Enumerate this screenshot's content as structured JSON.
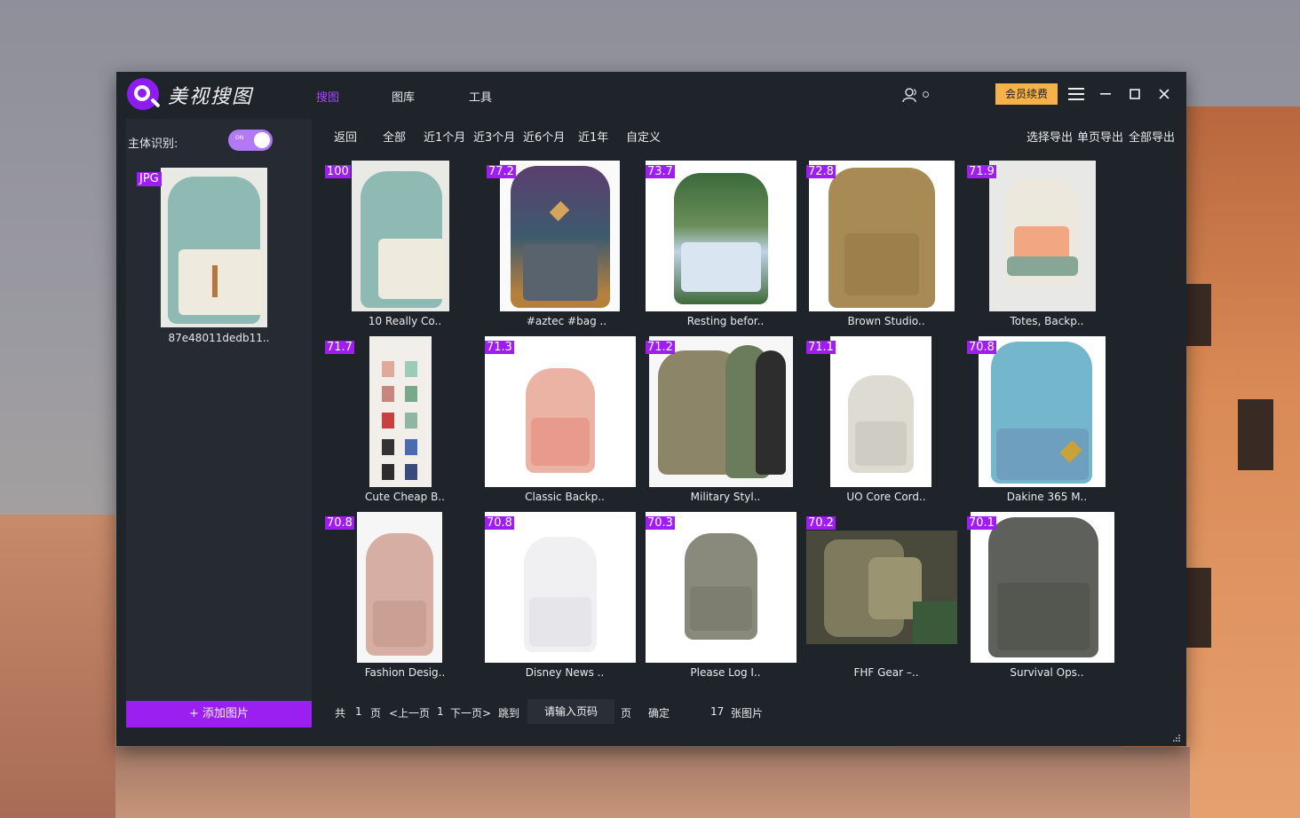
{
  "app": {
    "title": "美视搜图",
    "tabs": [
      {
        "label": "搜图",
        "active": true
      },
      {
        "label": "图库",
        "active": false
      },
      {
        "label": "工具",
        "active": false
      }
    ],
    "vip_button": "会员续费"
  },
  "sidebar": {
    "subject_label": "主体识别:",
    "toggle_on": true,
    "toggle_text": "ON",
    "query_badge": "JPG",
    "query_filename": "87e48011dedb11..",
    "add_button": "+ 添加图片"
  },
  "filters": {
    "items": [
      "返回",
      "全部",
      "近1个月",
      "近3个月",
      "近6个月",
      "近1年",
      "自定义"
    ],
    "exports": [
      "选择导出",
      "单页导出",
      "全部导出"
    ]
  },
  "results": [
    {
      "score": "100",
      "caption": "10 Really Co.."
    },
    {
      "score": "77.2",
      "caption": "#aztec #bag .."
    },
    {
      "score": "73.7",
      "caption": "Resting befor.."
    },
    {
      "score": "72.8",
      "caption": "Brown Studio.."
    },
    {
      "score": "71.9",
      "caption": "Totes, Backp.."
    },
    {
      "score": "71.7",
      "caption": "Cute Cheap B.."
    },
    {
      "score": "71.3",
      "caption": "Classic Backp.."
    },
    {
      "score": "71.2",
      "caption": "Military Styl.."
    },
    {
      "score": "71.1",
      "caption": "UO Core Cord.."
    },
    {
      "score": "70.8",
      "caption": "Dakine 365 M.."
    },
    {
      "score": "70.8",
      "caption": "Fashion Desig.."
    },
    {
      "score": "70.8",
      "caption": "Disney News .."
    },
    {
      "score": "70.3",
      "caption": "Please Log I.."
    },
    {
      "score": "70.2",
      "caption": "FHF Gear –.."
    },
    {
      "score": "70.1",
      "caption": "Survival Ops.."
    }
  ],
  "pagination": {
    "total_prefix": "共",
    "total_pages": "1",
    "page_unit": "页",
    "prev": "<上一页",
    "current": "1",
    "next": "下一页>",
    "jump": "跳到",
    "input_placeholder": "请输入页码",
    "page_suffix": "页",
    "confirm": "确定",
    "count": "17",
    "count_suffix": "张图片"
  },
  "colors": {
    "accent": "#9b1ff0",
    "window_bg": "#1f242b",
    "vip": "#f5b14a"
  }
}
